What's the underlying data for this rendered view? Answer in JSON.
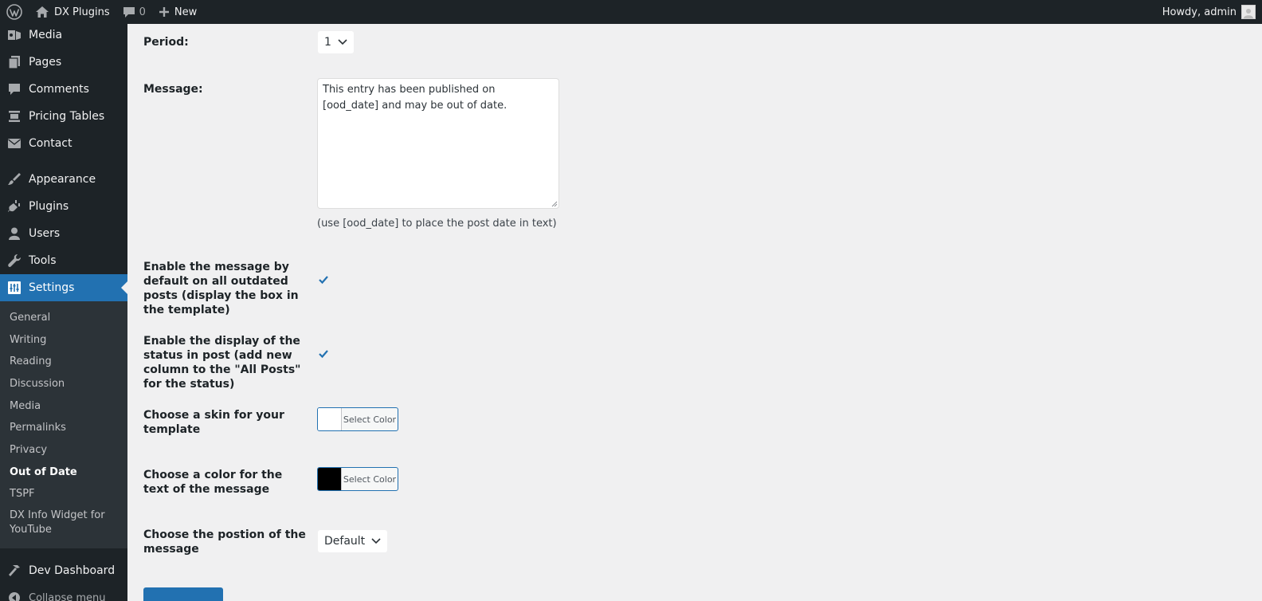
{
  "adminbar": {
    "site_name": "DX Plugins",
    "comments_count": "0",
    "new_label": "New",
    "howdy": "Howdy, admin"
  },
  "sidebar": {
    "items": [
      {
        "label": "Media",
        "icon": "media-icon"
      },
      {
        "label": "Pages",
        "icon": "pages-icon"
      },
      {
        "label": "Comments",
        "icon": "comments-icon"
      },
      {
        "label": "Pricing Tables",
        "icon": "pricing-tables-icon"
      },
      {
        "label": "Contact",
        "icon": "mail-icon"
      },
      {
        "label": "Appearance",
        "icon": "brush-icon"
      },
      {
        "label": "Plugins",
        "icon": "plug-icon"
      },
      {
        "label": "Users",
        "icon": "user-icon"
      },
      {
        "label": "Tools",
        "icon": "wrench-icon"
      },
      {
        "label": "Settings",
        "icon": "settings-icon"
      }
    ],
    "submenu": [
      "General",
      "Writing",
      "Reading",
      "Discussion",
      "Media",
      "Permalinks",
      "Privacy",
      "Out of Date",
      "TSPF",
      "DX Info Widget for YouTube"
    ],
    "dev_dashboard": "Dev Dashboard",
    "collapse": "Collapse menu"
  },
  "form": {
    "period_label": "Period:",
    "period_value": "1",
    "message_label": "Message:",
    "message_value": "This entry has been published on [ood_date] and may be out of date.",
    "message_hint": "(use [ood_date] to place the post date in text)",
    "enable_default_label": "Enable the message by default on all outdated posts (display the box in the template)",
    "enable_status_label": "Enable the display of the status in post (add new column to the \"All Posts\" for the status)",
    "skin_label": "Choose a skin for your template",
    "skin_button": "Select Color",
    "skin_color": "#ffffff",
    "text_color_label": "Choose a color for the text of the message",
    "text_color_button": "Select Color",
    "text_color": "#000000",
    "position_label": "Choose the postion of the message",
    "position_value": "Default"
  },
  "colors": {
    "accent": "#2271b1",
    "sidebar_bg": "#1d2327",
    "submenu_bg": "#2c3338",
    "content_bg": "#f0f0f1"
  }
}
